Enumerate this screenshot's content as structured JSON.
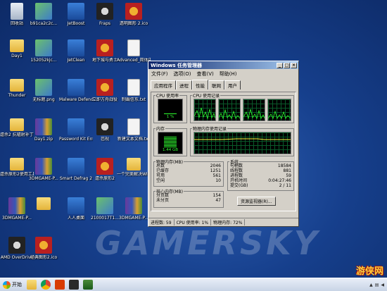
{
  "desktop": {
    "icons": [
      {
        "label": "回收站",
        "name": "recycle-bin-icon"
      },
      {
        "label": "b91ca2c2c...",
        "name": "image-file-icon"
      },
      {
        "label": "JetBoost",
        "name": "jetboost-icon"
      },
      {
        "label": "Fraps",
        "name": "fraps-icon"
      },
      {
        "label": "透明图形 2.ico",
        "name": "ico-file-icon"
      },
      {
        "label": "Day1",
        "name": "folder-icon"
      },
      {
        "label": "152052kjc...",
        "name": "image-file-icon"
      },
      {
        "label": "JetClean",
        "name": "jetclean-icon"
      },
      {
        "label": "地下城与勇士",
        "name": "dnf-game-icon"
      },
      {
        "label": "Advanced_简体中文...",
        "name": "text-file-icon"
      },
      {
        "label": "Thunder",
        "name": "folder-icon"
      },
      {
        "label": "无标题.png",
        "name": "image-file-icon"
      },
      {
        "label": "Malware Defender",
        "name": "malware-defender-icon"
      },
      {
        "label": "立即方舟战役",
        "name": "game-icon"
      },
      {
        "label": "制霸信东.txt",
        "name": "text-file-icon"
      },
      {
        "label": "虐杀2 抗辐射补丁包",
        "name": "folder-icon"
      },
      {
        "label": "Day1.zip",
        "name": "archive-icon"
      },
      {
        "label": "Password Kit Enterpris...",
        "name": "password-kit-icon"
      },
      {
        "label": "芭视",
        "name": "app-icon"
      },
      {
        "label": "新建文本文档.txt",
        "name": "text-file-icon"
      },
      {
        "label": "虐杀原形2使用工具",
        "name": "folder-icon"
      },
      {
        "label": "3DMGAME-P...",
        "name": "archive-icon"
      },
      {
        "label": "Smart Defrag 2",
        "name": "smart-defrag-icon"
      },
      {
        "label": "虐杀原形2",
        "name": "game-icon"
      },
      {
        "label": "一个完美解决WIN8A...",
        "name": "folder-icon"
      },
      {
        "label": "3DMGAME-P...",
        "name": "archive-icon"
      },
      {
        "label": "",
        "name": "folder-icon"
      },
      {
        "label": "人人桌面",
        "name": "renren-desktop-icon"
      },
      {
        "label": "2100017T1...",
        "name": "image-file-icon"
      },
      {
        "label": "3DMGAME-P...",
        "name": "archive-icon"
      },
      {
        "label": "AMD OverDrive",
        "name": "amd-overdrive-icon"
      },
      {
        "label": "经典图形2.ico",
        "name": "ico-file-icon"
      }
    ]
  },
  "task_manager": {
    "title": "Windows 任务管理器",
    "menu": [
      "文件(F)",
      "选项(O)",
      "查看(V)",
      "帮助(H)"
    ],
    "tabs": [
      "应用程序",
      "进程",
      "性能",
      "联网",
      "用户"
    ],
    "active_tab": "性能",
    "cpu_usage_label": "CPU 使用率",
    "cpu_usage_value": "1 %",
    "cpu_history_label": "CPU 使用记录",
    "mem_label": "内存",
    "mem_value": "1.44 GB",
    "mem_history_label": "物理内存使用记录",
    "physical_mem": {
      "title": "物理内存(MB)",
      "rows": [
        {
          "k": "总数",
          "v": "2046"
        },
        {
          "k": "已缓存",
          "v": "1251"
        },
        {
          "k": "可用",
          "v": "561"
        },
        {
          "k": "空闲",
          "v": "10"
        }
      ]
    },
    "system": {
      "title": "系统",
      "rows": [
        {
          "k": "句柄数",
          "v": "18584"
        },
        {
          "k": "线程数",
          "v": "881"
        },
        {
          "k": "进程数",
          "v": "59"
        },
        {
          "k": "开机时间",
          "v": "0:04:27:46"
        },
        {
          "k": "提交(GB)",
          "v": "2 / 11"
        }
      ]
    },
    "kernel_mem": {
      "title": "核心内存(MB)",
      "rows": [
        {
          "k": "分页数",
          "v": "154"
        },
        {
          "k": "未分页",
          "v": "47"
        }
      ]
    },
    "resource_monitor_button": "资源监视器(R)...",
    "status": {
      "processes": "进程数: 59",
      "cpu": "CPU 使用率: 1%",
      "memory": "物理内存: 72%"
    }
  },
  "watermark": "GAMERSKY",
  "logo_text": "游侠网",
  "taskbar": {
    "start_label": "开始"
  }
}
